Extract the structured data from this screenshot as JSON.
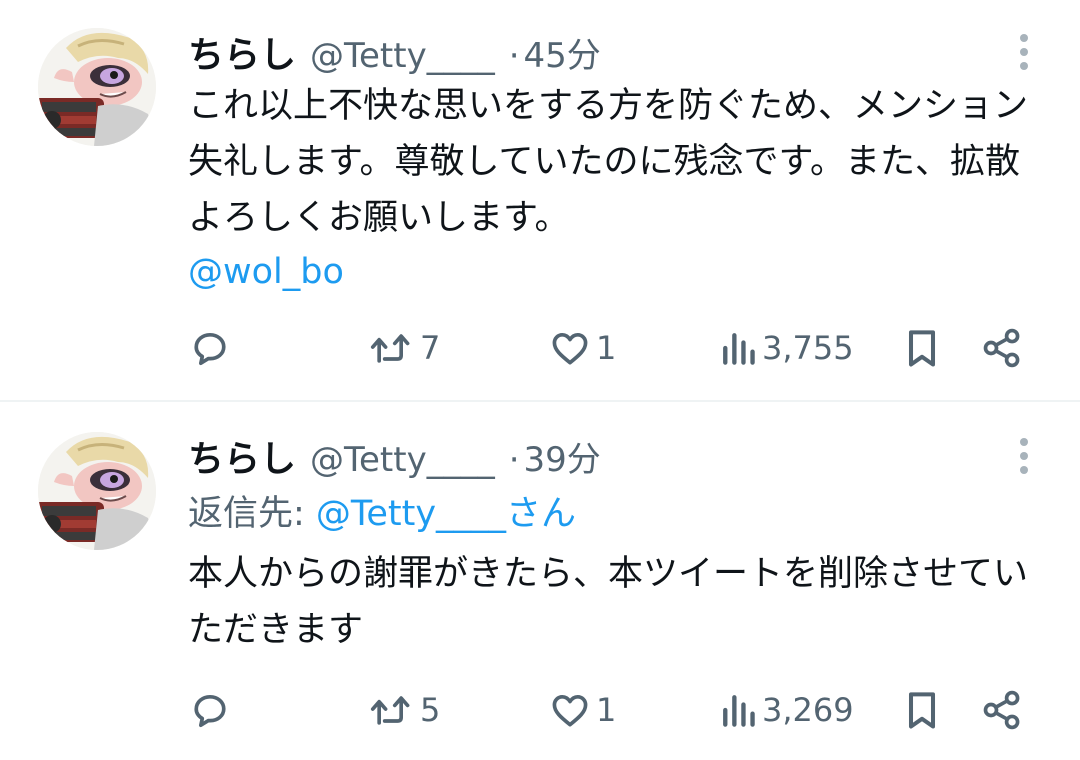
{
  "tweets": [
    {
      "display_name": "ちらし",
      "handle": "@Tetty____",
      "separator": "·",
      "time": "45分",
      "reply_to": null,
      "text": "これ以上不快な思いをする方を防ぐため、メンション失礼します。尊敬していたのに残念です。また、拡散よろしくお願いします。",
      "mention": "@wol_bo",
      "stats": {
        "replies": "",
        "retweets": "7",
        "likes": "1",
        "views": "3,755"
      }
    },
    {
      "display_name": "ちらし",
      "handle": "@Tetty____",
      "separator": "·",
      "time": "39分",
      "reply_to": {
        "prefix": "返信先: ",
        "handle": "@Tetty____さん"
      },
      "text": "本人からの謝罪がきたら、本ツイートを削除させていただきます",
      "mention": null,
      "stats": {
        "replies": "",
        "retweets": "5",
        "likes": "1",
        "views": "3,269"
      }
    }
  ],
  "icons": {
    "reply": "speech-bubble-icon",
    "retweet": "retweet-arrows-icon",
    "like": "heart-outline-icon",
    "views": "bar-chart-icon",
    "bookmark": "bookmark-icon",
    "share": "share-nodes-icon",
    "more": "vertical-ellipsis-icon"
  },
  "colors": {
    "text": "#0f1419",
    "secondary": "#536471",
    "link": "#1d9bf0",
    "divider": "#eff3f4"
  }
}
